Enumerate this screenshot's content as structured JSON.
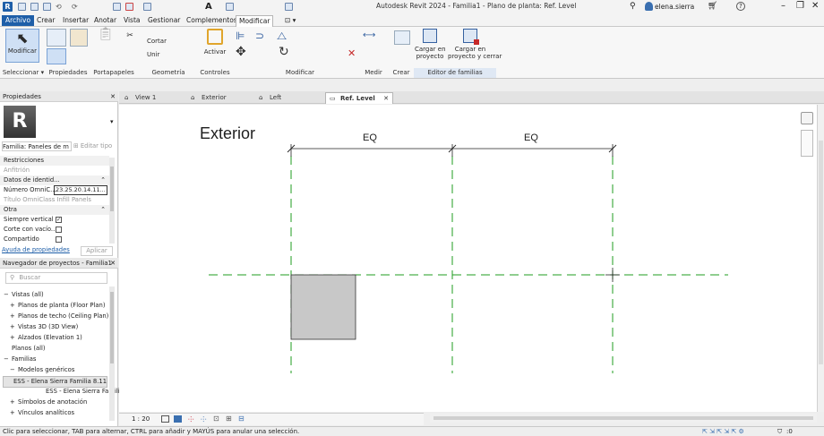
{
  "window": {
    "title": "Autodesk Revit 2024 - Familia1 - Plano de planta: Ref. Level",
    "user": "elena.sierra"
  },
  "ribbon_tabs": [
    "Archivo",
    "Crear",
    "Insertar",
    "Anotar",
    "Vista",
    "Gestionar",
    "Complementos",
    "Modificar"
  ],
  "ribbon": {
    "modificar": "Modificar",
    "cortar": "Cortar",
    "unir": "Unir",
    "activar": "Activar",
    "cargar_proyecto": "Cargar en\nproyecto",
    "cargar_cerrar": "Cargar en\nproyecto y cerrar",
    "panels": [
      "Seleccionar",
      "Propiedades",
      "Portapapeles",
      "Geometría",
      "Controles",
      "Modificar",
      "Medir",
      "Crear",
      "Editor de familias"
    ]
  },
  "properties": {
    "header": "Propiedades",
    "family_type": "Familia: Paneles de m",
    "edit_type": "Editar tipo",
    "rows": [
      {
        "label": "Restricciones",
        "cat": true
      },
      {
        "label": "Anfitrión",
        "muted": true
      },
      {
        "label": "Datos de identid...",
        "cat": true
      },
      {
        "label": "Número OmniC...",
        "value": "23.25.20.14.11..."
      },
      {
        "label": "Título OmniClass",
        "value": "Infill Panels",
        "muted": true
      },
      {
        "label": "Otra",
        "cat": true
      },
      {
        "label": "Siempre vertical",
        "check": true
      },
      {
        "label": "Corte con vacío...",
        "check": false
      },
      {
        "label": "Compartido",
        "check": false
      }
    ],
    "help_link": "Ayuda de propiedades",
    "apply": "Aplicar"
  },
  "browser": {
    "header": "Navegador de proyectos - Familia1",
    "search_placeholder": "Buscar",
    "items": [
      {
        "label": "Vistas (all)",
        "level": 0,
        "toggle": "−"
      },
      {
        "label": "Planos de planta (Floor Plan)",
        "level": 1,
        "toggle": "+"
      },
      {
        "label": "Planos de techo (Ceiling Plan)",
        "level": 1,
        "toggle": "+"
      },
      {
        "label": "Vistas 3D (3D View)",
        "level": 1,
        "toggle": "+"
      },
      {
        "label": "Alzados (Elevation 1)",
        "level": 1,
        "toggle": "+"
      },
      {
        "label": "Planos (all)",
        "level": 0,
        "toggle": ""
      },
      {
        "label": "Familias",
        "level": 0,
        "toggle": "−"
      },
      {
        "label": "Modelos genéricos",
        "level": 1,
        "toggle": "−"
      },
      {
        "label": "ESS - Elena Sierra Familia 8.11",
        "level": 2,
        "toggle": "",
        "selected": true
      },
      {
        "label": "ESS - Elena Sierra Familia",
        "level": 3,
        "toggle": ""
      },
      {
        "label": "Símbolos de anotación",
        "level": 1,
        "toggle": "+"
      },
      {
        "label": "Vínculos analíticos",
        "level": 1,
        "toggle": "+"
      }
    ]
  },
  "view_tabs": [
    "View 1",
    "Exterior",
    "Left",
    "Ref. Level"
  ],
  "drawing": {
    "exterior_label": "Exterior",
    "dim1": "EQ",
    "dim2": "EQ"
  },
  "view_control": {
    "scale": "1 : 20"
  },
  "status": {
    "text": "Clic para seleccionar, TAB para alternar, CTRL para añadir y MAYÚS para anular una selección.",
    "filter_count": ":0"
  }
}
